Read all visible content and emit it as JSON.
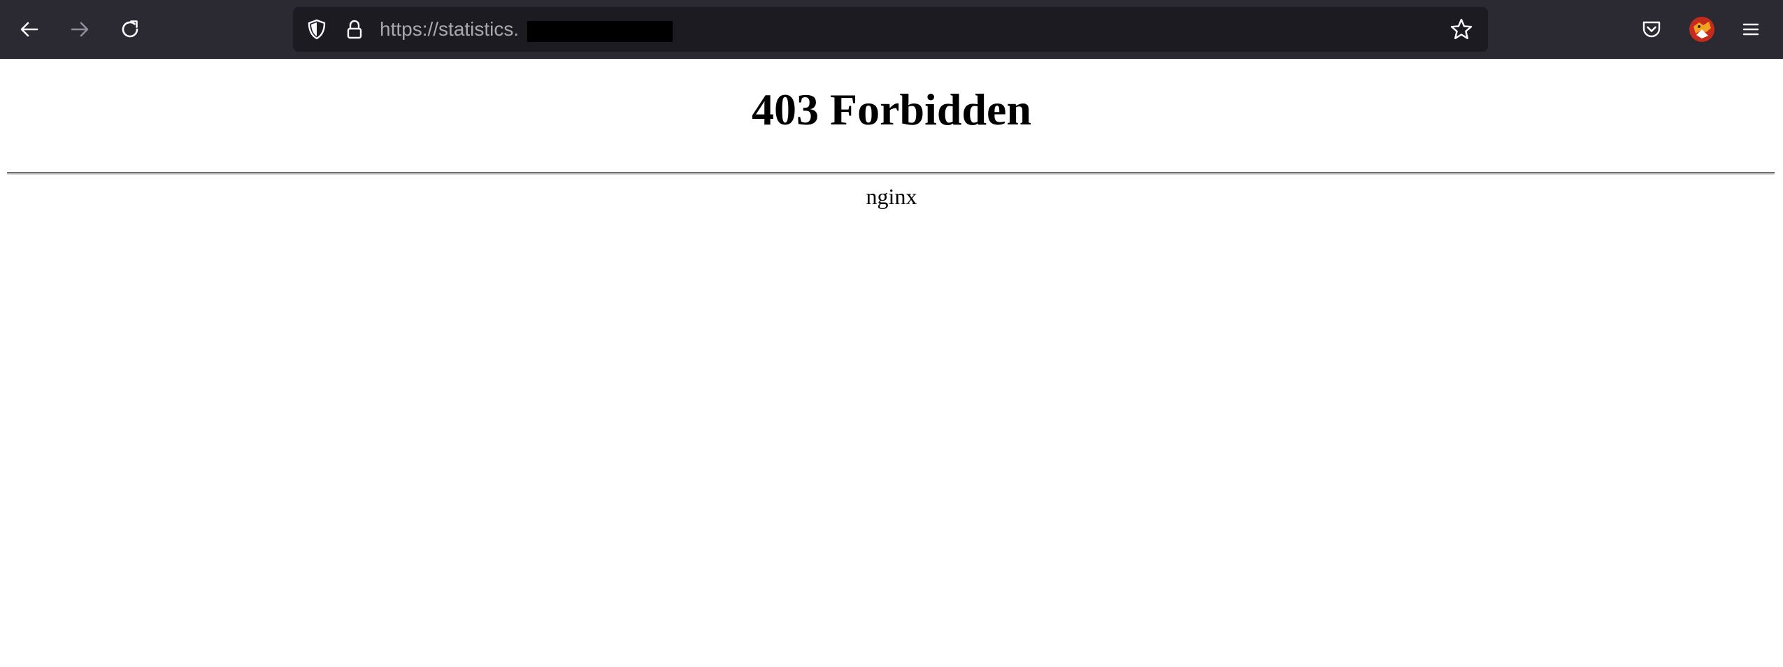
{
  "browser": {
    "url_text": "https://statistics.",
    "colors": {
      "toolbar_bg": "#2b2a33",
      "urlbar_bg": "#1c1b22",
      "icon": "#fbfbfe",
      "icon_disabled": "#8f8f9d",
      "url_text": "#a8a8ad"
    },
    "icons": {
      "back": "arrow-left-icon",
      "forward": "arrow-right-icon",
      "reload": "reload-icon",
      "tracking_protection": "shield-icon",
      "connection_secure": "lock-icon",
      "bookmark": "star-icon",
      "pocket": "pocket-icon",
      "account": "avatar",
      "menu": "hamburger-menu-icon"
    }
  },
  "page": {
    "title": "403 Forbidden",
    "server": "nginx"
  }
}
